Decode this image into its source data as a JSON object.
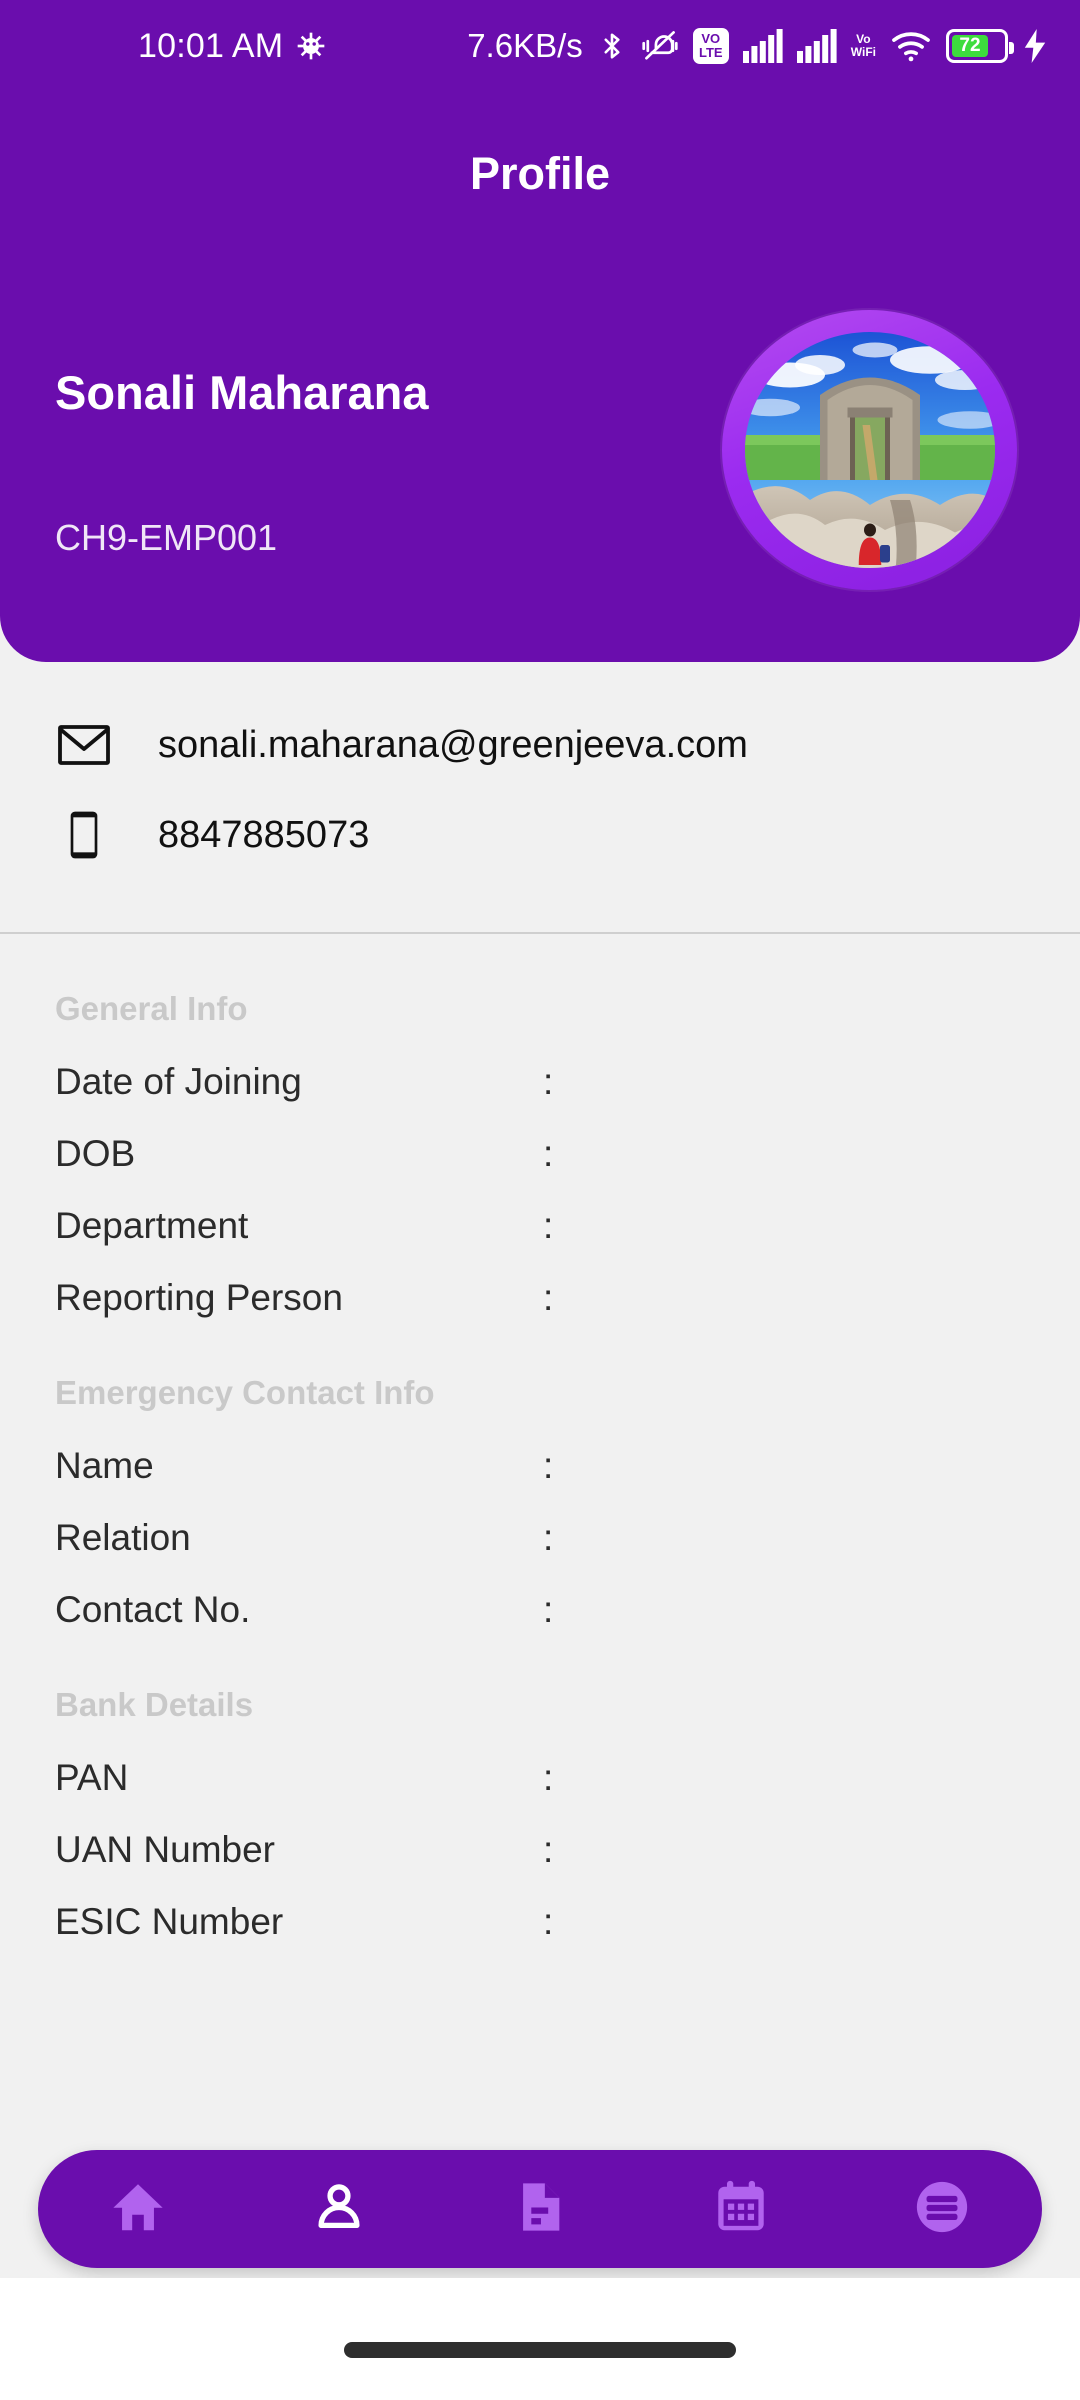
{
  "status_bar": {
    "time": "10:01 AM",
    "network_speed": "7.6KB/s",
    "battery_percent": "72",
    "icons": [
      "android-head-icon",
      "bluetooth-icon",
      "vibrate-off-icon",
      "volte-icon",
      "signal-bars-icon",
      "signal-bars-icon",
      "vowifi-icon",
      "wifi-icon",
      "battery-icon",
      "charging-bolt-icon"
    ],
    "volte_top": "VO",
    "volte_bottom": "LTE",
    "vowifi_top": "Vo",
    "vowifi_bottom": "WiFi"
  },
  "header": {
    "title": "Profile",
    "employee_name": "Sonali Maharana",
    "employee_id": "CH9-EMP001",
    "accent_color": "#6a0dad",
    "avatar_ring_color": "#9b2bf0"
  },
  "contact": {
    "email": "sonali.maharana@greenjeeva.com",
    "phone": "8847885073"
  },
  "sections": [
    {
      "title": "General Info",
      "rows": [
        {
          "label": "Date of Joining",
          "separator": ":",
          "value": ""
        },
        {
          "label": "DOB",
          "separator": ":",
          "value": ""
        },
        {
          "label": "Department",
          "separator": ":",
          "value": ""
        },
        {
          "label": "Reporting Person",
          "separator": ":",
          "value": ""
        }
      ]
    },
    {
      "title": "Emergency Contact Info",
      "rows": [
        {
          "label": "Name",
          "separator": ":",
          "value": ""
        },
        {
          "label": "Relation",
          "separator": ":",
          "value": ""
        },
        {
          "label": "Contact No.",
          "separator": ":",
          "value": ""
        }
      ]
    },
    {
      "title": "Bank Details",
      "rows": [
        {
          "label": "PAN",
          "separator": ":",
          "value": ""
        },
        {
          "label": "UAN Number",
          "separator": ":",
          "value": ""
        },
        {
          "label": "ESIC Number",
          "separator": ":",
          "value": ""
        }
      ]
    }
  ],
  "bottom_nav": {
    "items": [
      {
        "icon": "home-icon",
        "active": false
      },
      {
        "icon": "person-icon",
        "active": true
      },
      {
        "icon": "document-icon",
        "active": false
      },
      {
        "icon": "calendar-icon",
        "active": false
      },
      {
        "icon": "menu-icon",
        "active": false
      }
    ],
    "inactive_color": "#b163ee",
    "active_color": "#ffffff"
  }
}
